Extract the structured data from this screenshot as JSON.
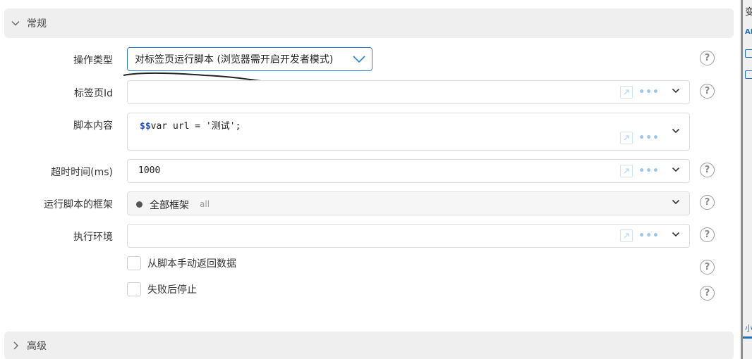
{
  "general": {
    "title": "常规"
  },
  "advanced": {
    "title": "高级"
  },
  "rows": {
    "operation_type": {
      "label": "操作类型",
      "value": "对标签页运行脚本 (浏览器需开启开发者模式)"
    },
    "tab_id": {
      "label": "标签页Id",
      "value": ""
    },
    "script": {
      "label": "脚本内容",
      "prefix": "$$",
      "value": "var url = '测试';"
    },
    "timeout": {
      "label": "超时时间(ms)",
      "value": "1000"
    },
    "frame": {
      "label": "运行脚本的框架",
      "value": "全部框架",
      "sub": "all"
    },
    "env": {
      "label": "执行环境",
      "value": ""
    }
  },
  "checkboxes": {
    "manual_return": {
      "label": "从脚本手动返回数据",
      "checked": false
    },
    "stop_on_fail": {
      "label": "失败后停止",
      "checked": false
    }
  },
  "help_glyph": "?",
  "dots_glyph": "•••",
  "right_strip": {
    "items": [
      "变",
      "AB",
      "小文"
    ]
  },
  "colors": {
    "accent": "#2a7fd4",
    "dots": "#9ec7ec",
    "header_bg": "#efefef"
  }
}
